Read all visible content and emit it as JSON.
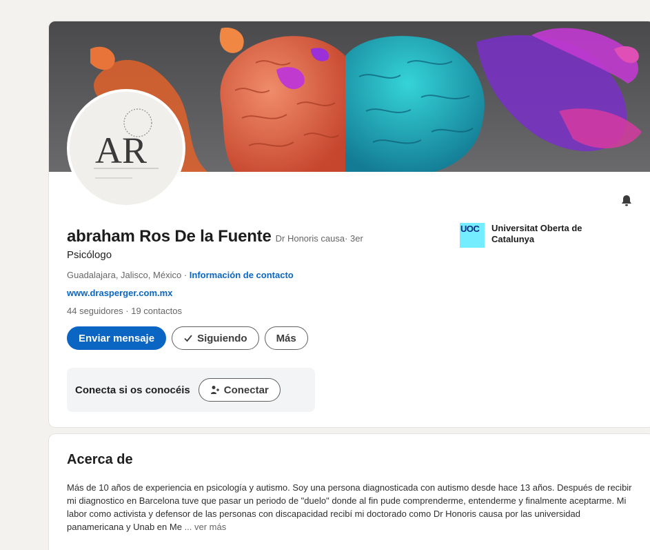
{
  "profile": {
    "name": "abraham Ros De la Fuente",
    "name_suffix": "Dr Honoris causa",
    "degree": " · 3er",
    "headline": "Psicólogo",
    "location": "Guadalajara, Jalisco, México",
    "location_separator": " · ",
    "contact_info_link": "Información de contacto",
    "website": "www.drasperger.com.mx",
    "followers": "44 seguidores",
    "stats_separator": " · ",
    "contacts": "19 contactos",
    "avatar_monogram": "AR"
  },
  "actions": {
    "message_label": "Enviar mensaje",
    "following_label": "Siguiendo",
    "more_label": "Más"
  },
  "connect": {
    "prompt": "Conecta si os conocéis",
    "button_label": "Conectar"
  },
  "education": {
    "logo_text": "UOC",
    "name": "Universitat Oberta de Catalunya"
  },
  "about": {
    "title": "Acerca de",
    "text": "Más de 10 años de experiencia en psicología y autismo. Soy una persona diagnosticada con autismo desde hace 13 años. Después de recibir mi diagnostico en Barcelona tuve que pasar un periodo de \"duelo\" donde al fin pude comprenderme, entenderme y finalmente aceptarme. Mi labor como activista y defensor de las personas con discapacidad recibí mi doctorado como Dr Honoris causa por las universidad panamericana y Unab en Me",
    "see_more": "... ver más"
  },
  "colors": {
    "accent": "#0a66c2",
    "uoc_logo_bg": "#73edff",
    "page_bg": "#f3f2ef"
  },
  "icons": {
    "bell": "bell-icon",
    "check": "check-icon",
    "connect": "add-person-icon"
  }
}
